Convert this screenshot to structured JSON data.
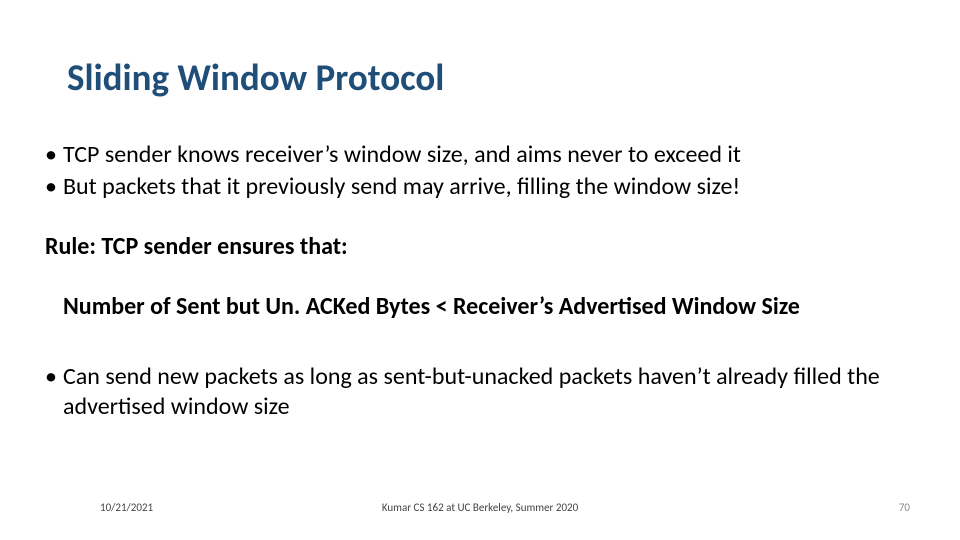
{
  "title": "Sliding Window Protocol",
  "bullets": [
    "TCP sender knows receiver’s window size, and aims never to exceed it",
    "But packets that it previously send may arrive, filling the window size!",
    "Can send new packets as long as sent-but-unacked packets haven’t already filled the advertised window size"
  ],
  "rule": {
    "line1": "Rule: TCP sender ensures that:",
    "line2": "Number of Sent but Un. ACKed Bytes < Receiver’s Advertised Window Size"
  },
  "footer": {
    "date": "10/21/2021",
    "center": "Kumar CS 162 at UC Berkeley, Summer 2020",
    "page": "70"
  }
}
